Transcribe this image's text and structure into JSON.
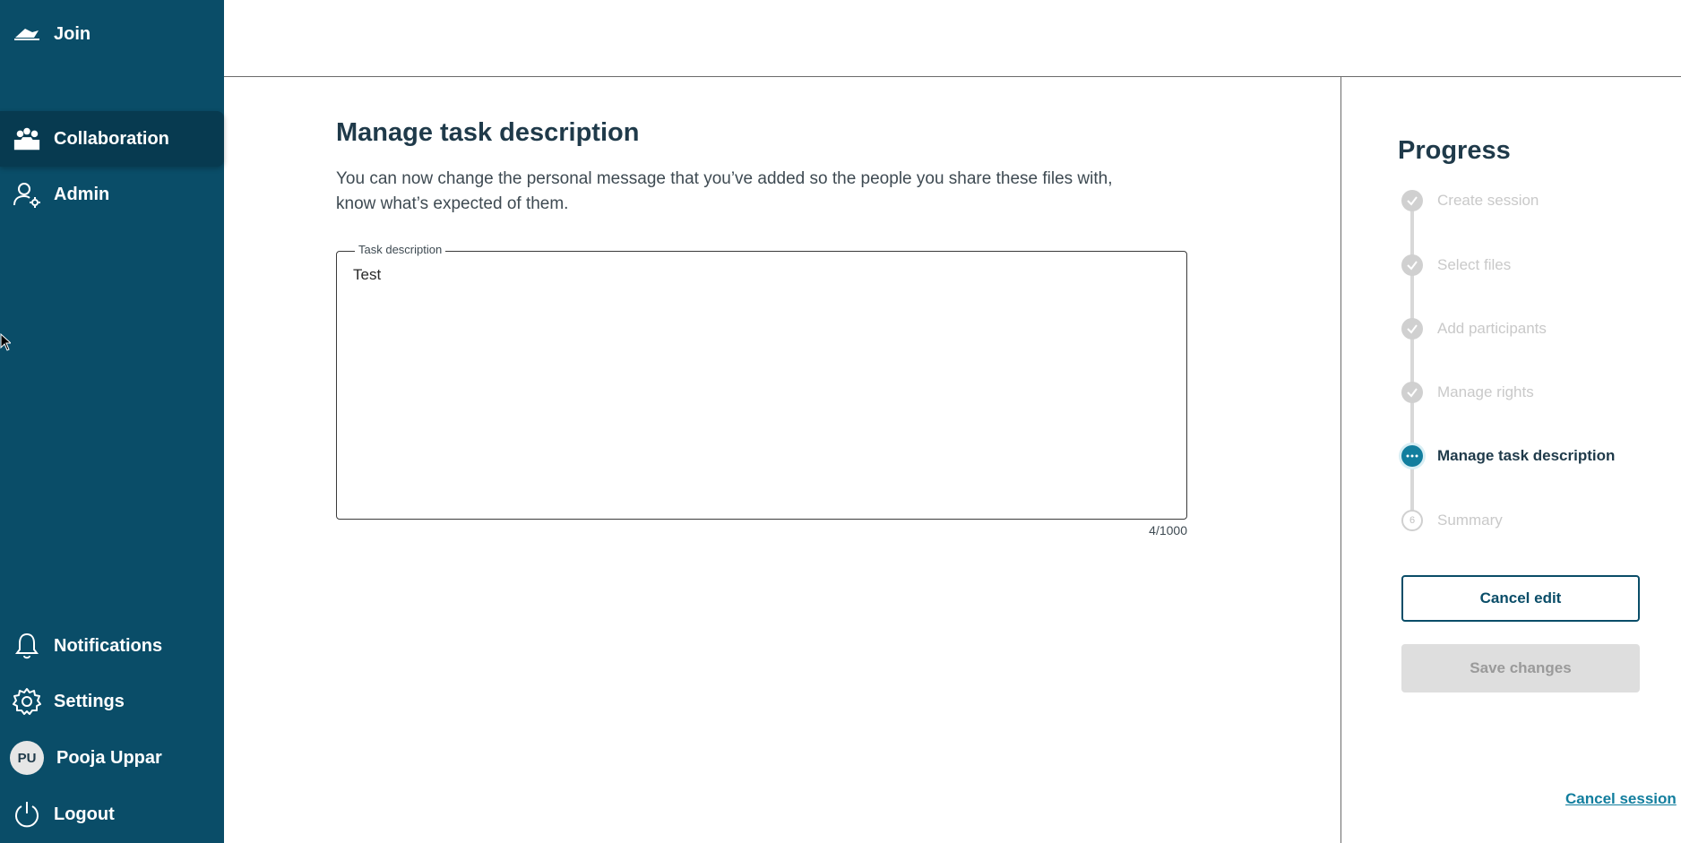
{
  "sidebar": {
    "join": "Join",
    "collaboration": "Collaboration",
    "admin": "Admin",
    "notifications": "Notifications",
    "settings": "Settings",
    "user_initials": "PU",
    "user_name": "Pooja Uppar",
    "logout": "Logout",
    "icons": [
      "cloud-icon",
      "people-icon",
      "admin-user-icon",
      "bell-icon",
      "gear-icon",
      "power-icon"
    ]
  },
  "main": {
    "title": "Manage task description",
    "description": "You can now change the personal message that you’ve added so the people you share these files with, know what’s expected of them.",
    "field_label": "Task description",
    "field_value": "Test",
    "counter": "4/1000"
  },
  "progress": {
    "title": "Progress",
    "steps": [
      {
        "label": "Create session",
        "state": "done"
      },
      {
        "label": "Select files",
        "state": "done"
      },
      {
        "label": "Add participants",
        "state": "done"
      },
      {
        "label": "Manage rights",
        "state": "done"
      },
      {
        "label": "Manage task description",
        "state": "current"
      },
      {
        "label": "Summary",
        "state": "todo",
        "number": "6"
      }
    ],
    "cancel_edit": "Cancel edit",
    "save_changes": "Save changes",
    "cancel_session": "Cancel session"
  },
  "colors": {
    "sidebar_bg": "#0a4d68",
    "accent": "#127e9e"
  }
}
